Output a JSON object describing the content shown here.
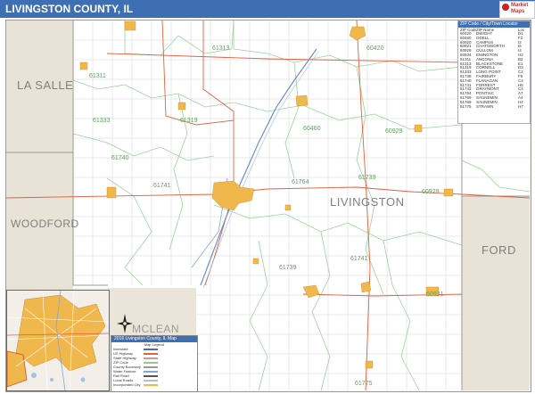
{
  "title": "LIVINGSTON COUNTY, IL",
  "logo_text": "Market Maps",
  "county_name": "LIVINGSTON",
  "neighbor_counties": [
    {
      "name": "LA SALLE"
    },
    {
      "name": "WOODFORD"
    },
    {
      "name": "FORD"
    },
    {
      "name": "MCLEAN"
    }
  ],
  "zip_labels": [
    "61313",
    "60420",
    "61311",
    "60460",
    "61319",
    "61333",
    "60929",
    "61740",
    "61741",
    "61764",
    "61739",
    "60929",
    "61775",
    "61739",
    "61741",
    "60921"
  ],
  "zip_table": {
    "header": "ZIP Code / City/Town Locator",
    "columns": [
      "ZIP Code",
      "ZIP Name",
      "Loc"
    ],
    "rows": [
      [
        "60420",
        "DWIGHT",
        "D1"
      ],
      [
        "60460",
        "ODELL",
        "F2"
      ],
      [
        "60920",
        "CAMPUS",
        "I2"
      ],
      [
        "60921",
        "CHATSWORTH",
        "I6"
      ],
      [
        "60929",
        "CULLOM",
        "I4"
      ],
      [
        "60934",
        "EMINGTON",
        "H2"
      ],
      [
        "61311",
        "ANCONA",
        "B2"
      ],
      [
        "61313",
        "BLACKSTONE",
        "E1"
      ],
      [
        "61319",
        "CORNELL",
        "D3"
      ],
      [
        "61333",
        "LONG POINT",
        "C2"
      ],
      [
        "61739",
        "FAIRBURY",
        "F5"
      ],
      [
        "61740",
        "FLANAGAN",
        "C4"
      ],
      [
        "61741",
        "FORREST",
        "H5"
      ],
      [
        "61743",
        "GRAYMONT",
        "C4"
      ],
      [
        "61764",
        "PONTIAC",
        "A7"
      ],
      [
        "61769",
        "SAUNEMIN",
        "A4"
      ],
      [
        "61769",
        "SAUNEMIN",
        "H4"
      ],
      [
        "61775",
        "STRAWN",
        "H7"
      ]
    ]
  },
  "legend": {
    "title": "2016 Livingston County, IL Map",
    "subtitle": "Map Legend",
    "items": [
      {
        "label": "Interstate",
        "color": "#4a6fb0"
      },
      {
        "label": "US Highway",
        "color": "#e06040"
      },
      {
        "label": "State Highway",
        "color": "#e09090"
      },
      {
        "label": "ZIP Code",
        "color": "#8fcc8f"
      },
      {
        "label": "County Boundary",
        "color": "#999999"
      },
      {
        "label": "Water Feature",
        "color": "#7fa8d8"
      },
      {
        "label": "Rail Road",
        "color": "#555555"
      },
      {
        "label": "Local Roads",
        "color": "#bbbbbb"
      },
      {
        "label": "Incorporated City",
        "color": "#f0b84c"
      }
    ]
  },
  "colors": {
    "title_bar": "#3f6fb3",
    "city": "#f0b84c",
    "zip_boundary": "#8fcc8f",
    "highway": "#e06040",
    "water": "#7fa8d8",
    "neighbor_fill": "#e8e0d4"
  }
}
